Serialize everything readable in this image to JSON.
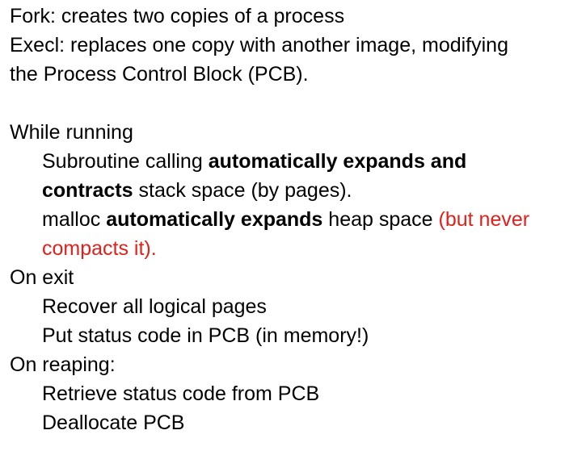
{
  "accent_color": "#e0201b",
  "text_color": "#000000",
  "intro": {
    "fork": "Fork: creates two copies of a process",
    "execl_1": "Execl: replaces one copy with another image, modifying",
    "execl_2": "the Process Control Block (PCB)."
  },
  "while_running": {
    "heading": "While running",
    "subroutine": {
      "a": "Subroutine calling ",
      "b1": "automatically expands and",
      "b2": "contracts",
      "c": " stack space (by pages)."
    },
    "malloc": {
      "a": "malloc ",
      "b": "automatically expands",
      "c": " heap space ",
      "red1": "(but never",
      "red2": "compacts it)."
    }
  },
  "on_exit": {
    "heading": "On exit",
    "items": [
      "Recover all logical pages",
      "Put status code in PCB (in memory!)"
    ]
  },
  "on_reaping": {
    "heading": "On reaping:",
    "items": [
      "Retrieve status code from PCB",
      "Deallocate PCB"
    ]
  }
}
